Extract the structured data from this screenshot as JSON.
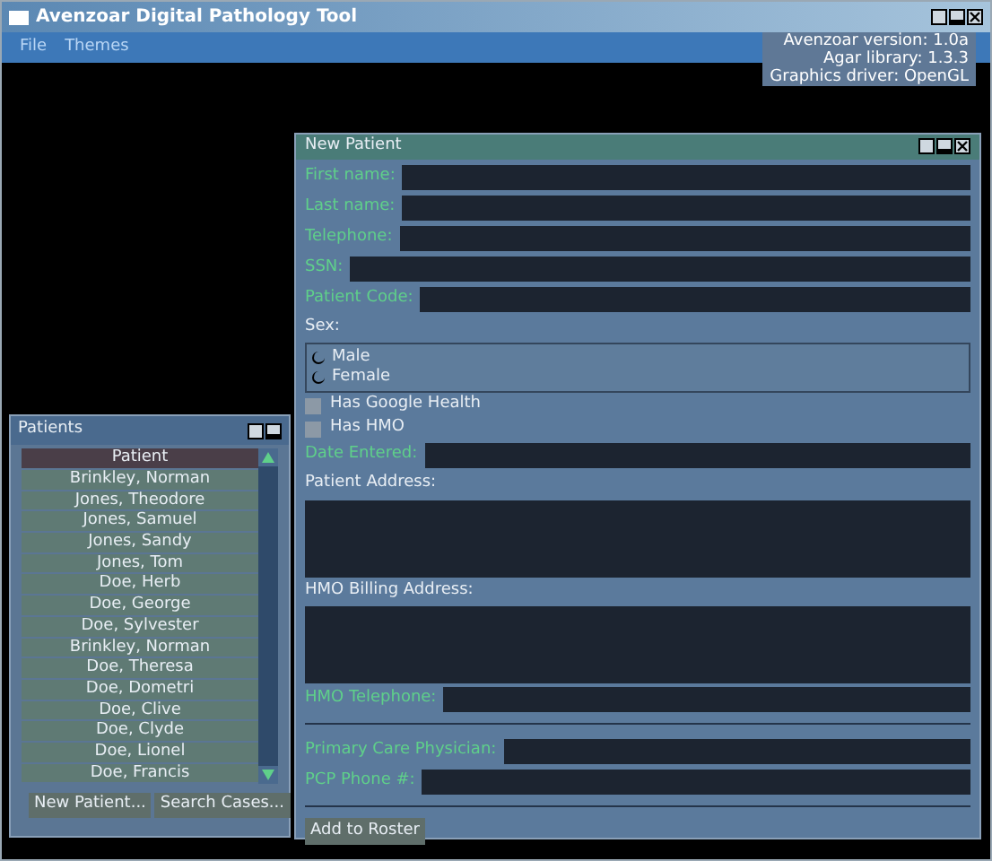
{
  "window": {
    "title": "Avenzoar Digital Pathology Tool"
  },
  "menu": [
    "File",
    "Themes"
  ],
  "about": [
    "Avenzoar version: 1.0a",
    "Agar library: 1.3.3",
    "Graphics driver: OpenGL"
  ],
  "patients": {
    "title": "Patients",
    "column": "Patient",
    "rows": [
      "Brinkley, Norman",
      "Jones, Theodore",
      "Jones, Samuel",
      "Jones, Sandy",
      "Jones, Tom",
      "Doe, Herb",
      "Doe, George",
      "Doe, Sylvester",
      "Brinkley, Norman",
      "Doe, Theresa",
      "Doe, Dometri",
      "Doe, Clive",
      "Doe, Clyde",
      "Doe, Lionel",
      "Doe, Francis"
    ],
    "buttons": [
      "New Patient...",
      "Search Cases..."
    ]
  },
  "new_patient": {
    "title": "New Patient",
    "sections": [
      [
        {
          "kind": "field",
          "label": "First name:"
        },
        {
          "kind": "field",
          "label": "Last name:"
        },
        {
          "kind": "field",
          "label": "Telephone:"
        },
        {
          "kind": "field",
          "label": "SSN:"
        },
        {
          "kind": "field",
          "label": "Patient Code:"
        },
        {
          "kind": "radio",
          "label": "Sex:",
          "options": [
            {
              "label": "Male",
              "selected": false
            },
            {
              "label": "Female",
              "selected": false
            }
          ]
        },
        {
          "kind": "checkbox",
          "label": "Has Google Health",
          "checked": false
        },
        {
          "kind": "checkbox",
          "label": "Has HMO",
          "checked": false
        },
        {
          "kind": "field",
          "label": "Date Entered:"
        },
        {
          "kind": "area",
          "label": "Patient Address:"
        },
        {
          "kind": "area",
          "label": "HMO Billing Address:"
        },
        {
          "kind": "field",
          "label": "HMO Telephone:"
        }
      ],
      [
        {
          "kind": "field",
          "label": "Primary Care Physician:"
        },
        {
          "kind": "field",
          "label": "PCP Phone #:"
        }
      ]
    ],
    "button": "Add to Roster"
  }
}
